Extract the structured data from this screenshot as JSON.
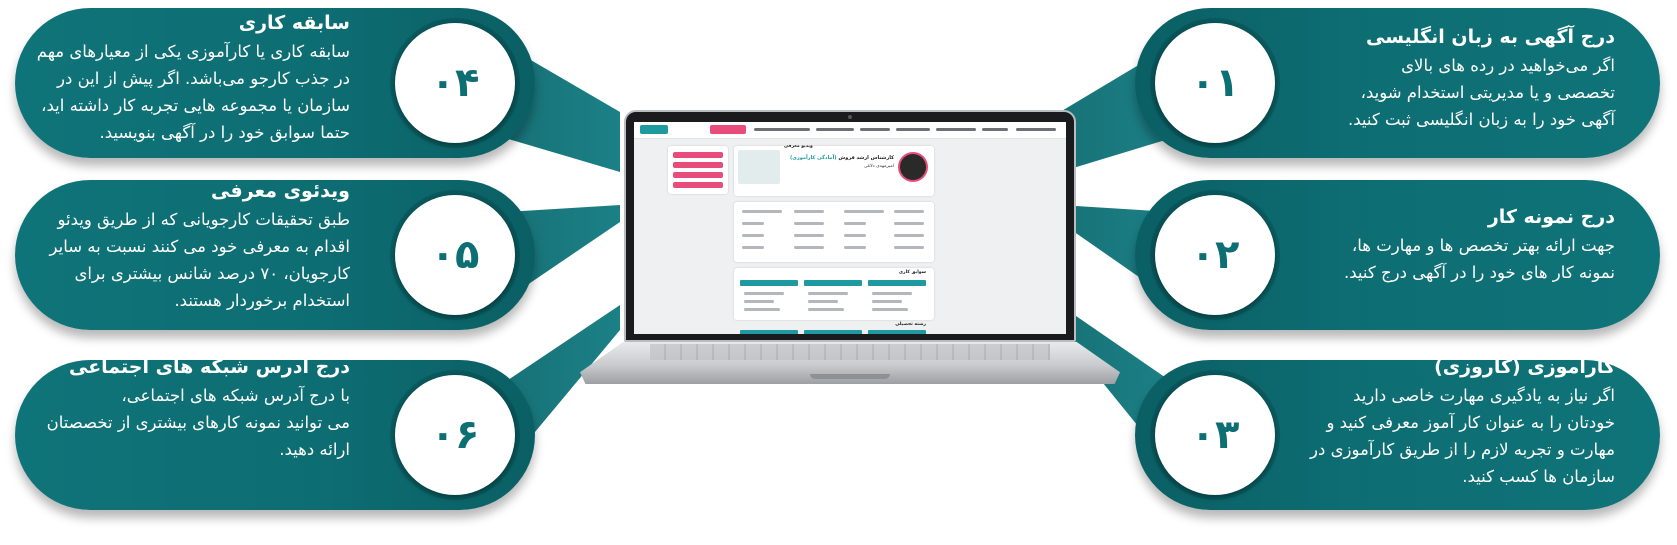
{
  "theme": {
    "card_color": "#0d6f74",
    "number_color": "#0d6f74",
    "text_color": "#ffffff",
    "accent_pink": "#e74c7a",
    "accent_teal": "#1e9aa0"
  },
  "features": [
    {
      "num": "۰۱",
      "title": "درج آگهی به زبان انگلیسی",
      "lines": [
        "اگر می‌خواهید در رده های بالای",
        "تخصصی و یا مدیریتی استخدام شوید،",
        "آگهی خود را به زبان انگلیسی ثبت کنید."
      ]
    },
    {
      "num": "۰۲",
      "title": "درج نمونه کار",
      "lines": [
        "جهت ارائه بهتر تخصص ها و مهارت ها،",
        "نمونه کار های خود را در آگهی درج کنید."
      ]
    },
    {
      "num": "۰۳",
      "title": "کارآموزی (کاروزی)",
      "lines": [
        "اگر نیاز به یادگیری مهارت خاصی دارید",
        "خودتان را به عنوان کار آموز معرفی کنید و",
        "مهارت و تجربه لازم را از طریق کارآموزی در",
        "سازمان ها کسب کنید."
      ]
    },
    {
      "num": "۰۴",
      "title": "سابقه کاری",
      "lines": [
        "سابقه کاری یا کارآموزی یکی از معیارهای مهم",
        "در جذب کارجو می‌باشد. اگر پیش از این در",
        "سازمان یا مجموعه هایی تجربه کار داشته اید،",
        "حتما سوابق خود را در آگهی بنویسید."
      ]
    },
    {
      "num": "۰۵",
      "title": "ویدئوی معرفی",
      "lines": [
        "طبق تحقیقات کارجویانی که از طریق ویدئو",
        "اقدام به معرفی خود می کنند نسبت به سایر",
        "کارجویان، ۷۰ درصد شانس بیشتری برای",
        "استخدام برخوردار هستند."
      ]
    },
    {
      "num": "۰۶",
      "title": "درج آدرس شبکه های اجتماعی",
      "lines": [
        "با درج آدرس شبکه های اجتماعی،",
        "می توانید نمونه کارهای بیشتری از تخصصتان",
        "ارائه دهید."
      ]
    }
  ],
  "screen": {
    "profile_name": "کارشناس ارشد فروش",
    "profile_tag": "(آمادگی کارآموزی)",
    "profile_sub": "امیرمهدی دلاغی",
    "video_label": "ویدیو معرفی",
    "history_label": "سوابق کاری",
    "edu_label": "رشته تحصیلی"
  }
}
